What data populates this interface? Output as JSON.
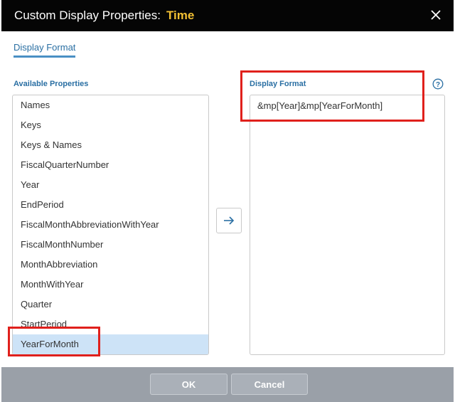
{
  "dialog": {
    "title_prefix": "Custom Display Properties:",
    "title_highlight": "Time"
  },
  "tabs": [
    {
      "label": "Display Format",
      "active": true
    }
  ],
  "available": {
    "label": "Available Properties",
    "items": [
      {
        "label": "Names"
      },
      {
        "label": "Keys"
      },
      {
        "label": "Keys & Names"
      },
      {
        "label": "FiscalQuarterNumber"
      },
      {
        "label": "Year"
      },
      {
        "label": "EndPeriod"
      },
      {
        "label": "FiscalMonthAbbreviationWithYear"
      },
      {
        "label": "FiscalMonthNumber"
      },
      {
        "label": "MonthAbbreviation"
      },
      {
        "label": "MonthWithYear"
      },
      {
        "label": "Quarter"
      },
      {
        "label": "StartPeriod"
      },
      {
        "label": "YearForMonth",
        "selected": true
      }
    ]
  },
  "format": {
    "label": "Display Format",
    "value": "&mp[Year]&mp[YearForMonth]"
  },
  "footer": {
    "ok_label": "OK",
    "cancel_label": "Cancel"
  },
  "colors": {
    "titlebar": "#050505",
    "title_accent": "#f2c033",
    "link_blue": "#2a6fa3",
    "selected_row": "#cde3f7",
    "annotation_red": "#e0201c",
    "footer": "#9aa0a8"
  }
}
